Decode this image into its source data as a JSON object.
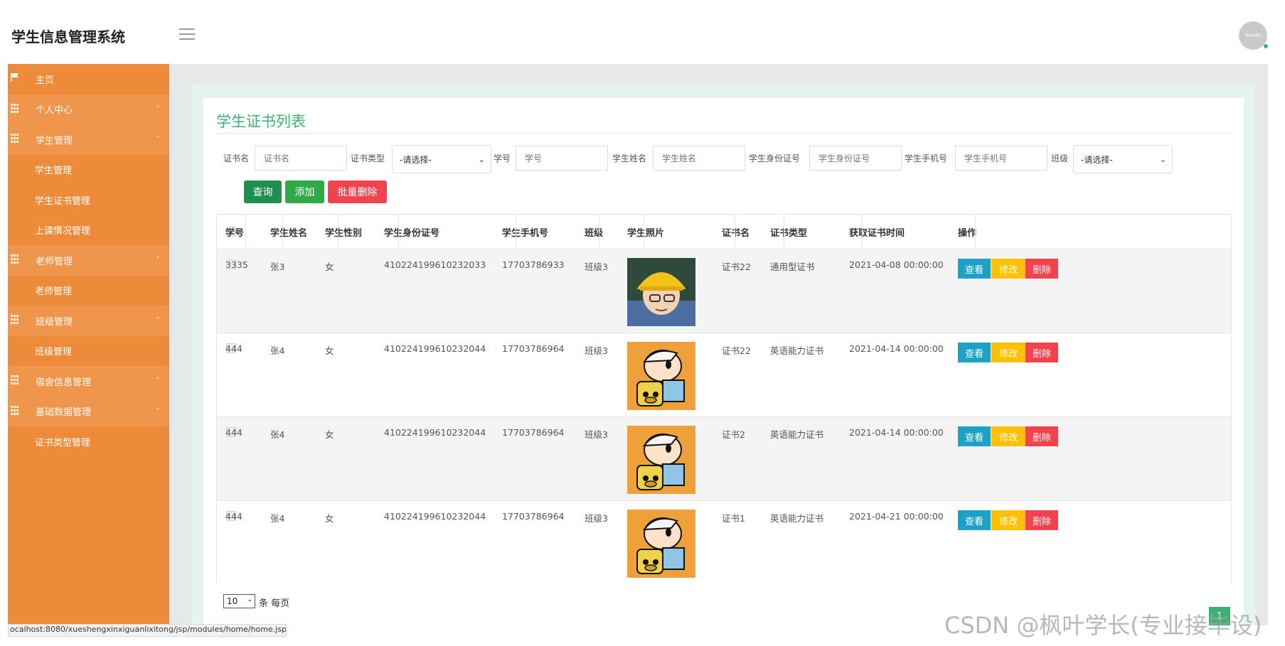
{
  "app": {
    "title": "学生信息管理系统",
    "avatar_text": "80x80"
  },
  "sidebar": {
    "items": [
      {
        "label": "主页",
        "icon": "flag-icon",
        "kind": "home"
      },
      {
        "label": "个人中心",
        "icon": "grid-icon",
        "kind": "parent",
        "caret": "˅"
      },
      {
        "label": "学生管理",
        "icon": "grid-icon",
        "kind": "parent",
        "caret": "˄"
      },
      {
        "label": "学生管理",
        "kind": "sub"
      },
      {
        "label": "学生证书管理",
        "kind": "sub"
      },
      {
        "label": "上课情况管理",
        "kind": "sub"
      },
      {
        "label": "老师管理",
        "icon": "grid-icon",
        "kind": "parent",
        "caret": "˄"
      },
      {
        "label": "老师管理",
        "kind": "sub"
      },
      {
        "label": "班级管理",
        "icon": "grid-icon",
        "kind": "parent",
        "caret": "˄"
      },
      {
        "label": "班级管理",
        "kind": "sub"
      },
      {
        "label": "宿舍信息管理",
        "icon": "grid-icon",
        "kind": "parent",
        "caret": "˅"
      },
      {
        "label": "基础数据管理",
        "icon": "grid-icon",
        "kind": "parent",
        "caret": "˄"
      },
      {
        "label": "证书类型管理",
        "kind": "sub"
      }
    ]
  },
  "page": {
    "title": "学生证书列表"
  },
  "filters": {
    "cert_name_label": "证书名",
    "cert_name_placeholder": "证书名",
    "cert_type_label": "证书类型",
    "cert_type_value": "-请选择-",
    "student_no_label": "学号",
    "student_no_placeholder": "学号",
    "student_name_label": "学生姓名",
    "student_name_placeholder": "学生姓名",
    "id_card_label": "学生身份证号",
    "id_card_placeholder": "学生身份证号",
    "phone_label": "学生手机号",
    "phone_placeholder": "学生手机号",
    "class_label": "班级",
    "class_value": "-请选择-"
  },
  "buttons": {
    "query": "查询",
    "add": "添加",
    "batch_delete": "批量删除",
    "colors": {
      "query": "#1f8f4e",
      "add": "#2eaa48",
      "batch_delete": "#f2424e"
    }
  },
  "table": {
    "headers": [
      "学号",
      "学生姓名",
      "学生性别",
      "学生身份证号",
      "学生手机号",
      "班级",
      "学生照片",
      "证书名",
      "证书类型",
      "获取证书时间",
      "操作"
    ],
    "rows": [
      {
        "no": "3335",
        "name": "张3",
        "gender": "女",
        "id_card": "410224199610232033",
        "phone": "17703786933",
        "class": "班级3",
        "photo": "boy-yellow-hat-photo",
        "cert": "证书22",
        "type": "通用型证书",
        "time": "2021-04-08 00:00:00"
      },
      {
        "no": "444",
        "name": "张4",
        "gender": "女",
        "id_card": "410224199610232044",
        "phone": "17703786964",
        "class": "班级3",
        "photo": "cartoon-kid-backpack-photo",
        "cert": "证书22",
        "type": "英语能力证书",
        "time": "2021-04-14 00:00:00"
      },
      {
        "no": "444",
        "name": "张4",
        "gender": "女",
        "id_card": "410224199610232044",
        "phone": "17703786964",
        "class": "班级3",
        "photo": "cartoon-kid-backpack-photo",
        "cert": "证书2",
        "type": "英语能力证书",
        "time": "2021-04-14 00:00:00"
      },
      {
        "no": "444",
        "name": "张4",
        "gender": "女",
        "id_card": "410224199610232044",
        "phone": "17703786964",
        "class": "班级3",
        "photo": "cartoon-kid-backpack-photo",
        "cert": "证书1",
        "type": "英语能力证书",
        "time": "2021-04-21 00:00:00"
      }
    ],
    "actions": {
      "view": "查看",
      "edit": "修改",
      "delete": "删除"
    },
    "action_colors": {
      "view": "#1ba2c6",
      "edit": "#ffc107",
      "delete": "#f2424e"
    }
  },
  "pagination": {
    "page_size": "10",
    "per_page_text": "条 每页",
    "current_page": "1"
  },
  "status_bar": {
    "url": "ocalhost:8080/xueshengxinxiguanlixitong/jsp/modules/home/home.jsp"
  },
  "watermark": "CSDN @枫叶学长(专业接毕设)",
  "colors": {
    "sidebar": "#ee8b3a",
    "accent_green": "#3bb273"
  }
}
